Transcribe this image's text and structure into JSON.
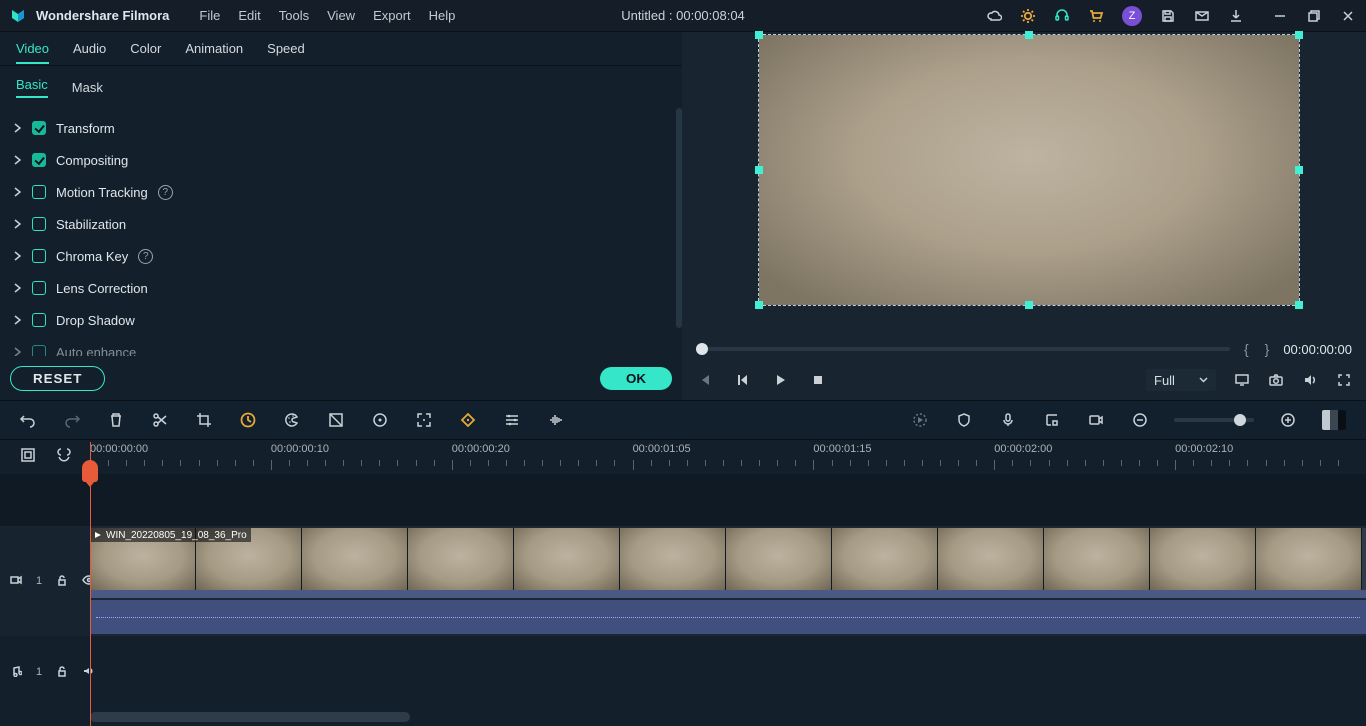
{
  "titlebar": {
    "app_name": "Wondershare Filmora",
    "menu": [
      "File",
      "Edit",
      "Tools",
      "View",
      "Export",
      "Help"
    ],
    "doc_title": "Untitled : 00:00:08:04",
    "avatar_letter": "Z"
  },
  "panel": {
    "primary_tabs": [
      "Video",
      "Audio",
      "Color",
      "Animation",
      "Speed"
    ],
    "primary_active": 0,
    "secondary_tabs": [
      "Basic",
      "Mask"
    ],
    "secondary_active": 0,
    "options": [
      {
        "label": "Transform",
        "checked": true,
        "help": false
      },
      {
        "label": "Compositing",
        "checked": true,
        "help": false
      },
      {
        "label": "Motion Tracking",
        "checked": false,
        "help": true
      },
      {
        "label": "Stabilization",
        "checked": false,
        "help": false
      },
      {
        "label": "Chroma Key",
        "checked": false,
        "help": true
      },
      {
        "label": "Lens Correction",
        "checked": false,
        "help": false
      },
      {
        "label": "Drop Shadow",
        "checked": false,
        "help": false
      },
      {
        "label": "Auto enhance",
        "checked": false,
        "help": false
      }
    ],
    "reset_btn": "RESET",
    "ok_btn": "OK"
  },
  "preview": {
    "time": "00:00:00:00",
    "quality_label": "Full"
  },
  "timeline": {
    "ruler": [
      "00:00:00:00",
      "00:00:00:10",
      "00:00:00:20",
      "00:00:01:05",
      "00:00:01:15",
      "00:00:02:00",
      "00:00:02:10"
    ],
    "clip_name": "WIN_20220805_19_08_36_Pro",
    "video_track_label": "1",
    "audio_track_label": "1"
  }
}
